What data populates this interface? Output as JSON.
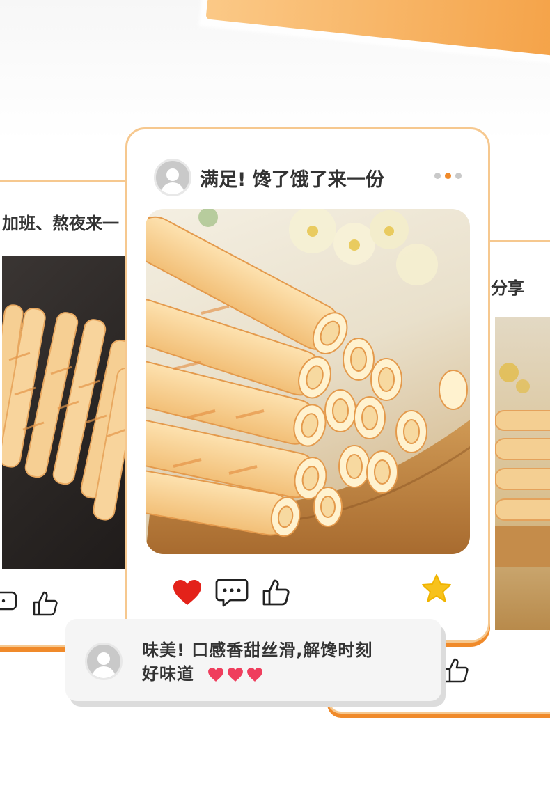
{
  "main_post": {
    "title": "满足! 馋了饿了来一份",
    "image": "egg-roll-biscuits-on-wooden-plate",
    "actions": [
      "heart-icon",
      "comment-icon",
      "thumbs-up-icon"
    ],
    "favorite": "star-icon",
    "page_indicator": {
      "count": 3,
      "active": 2
    }
  },
  "left_post": {
    "title": "加班、熬夜来一",
    "image": "egg-rolls-on-black-plate"
  },
  "right_post": {
    "title": "分享",
    "image": "egg-rolls-on-wooden-tray"
  },
  "comment": {
    "line1": "味美! 口感香甜丝滑,解馋时刻",
    "line2": "好味道",
    "hearts": 3
  },
  "colors": {
    "accent": "#f08a2a",
    "border": "#f6c88f",
    "heart": "#e3221a",
    "star": "#f7c21c",
    "comment_heart": "#ef3e5d"
  }
}
